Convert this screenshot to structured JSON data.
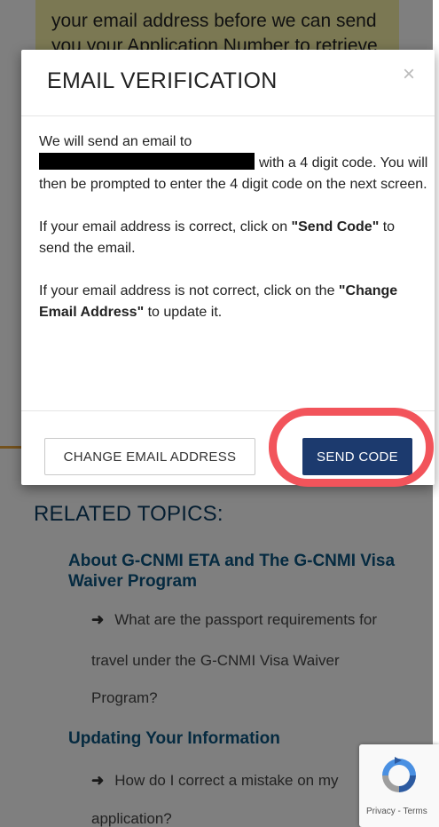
{
  "background": {
    "notice_text": "your email address before we can send you your Application Number to retrieve your",
    "related_title": "RELATED TOPICS:",
    "topics": [
      {
        "heading": "About G-CNMI ETA and The G-CNMI Visa Waiver Program",
        "link_first": "What are the passport requirements for",
        "link_rest_1": "travel under the G-CNMI Visa Waiver",
        "link_rest_2": "Program?"
      },
      {
        "heading": "Updating Your Information",
        "link_first": "How do I correct a mistake on my",
        "link_rest_1": "application?"
      }
    ],
    "arrow": "➜"
  },
  "modal": {
    "title": "EMAIL VERIFICATION",
    "close": "×",
    "p1_line1": "We will send an email to",
    "p1_after_redaction": "with a 4 digit code. You will then be prompted to enter the 4 digit code on the next screen.",
    "p2_before": "If your email address is correct, click on ",
    "p2_bold": "\"Send Code\"",
    "p2_after": " to send the email.",
    "p3_before": "If your email address is not correct, click on the ",
    "p3_bold": "\"Change Email Address\"",
    "p3_after": " to update it.",
    "buttons": {
      "change_email": "CHANGE EMAIL ADDRESS",
      "send_code": "SEND CODE"
    }
  },
  "recaptcha": {
    "label": "Privacy - Terms"
  },
  "colors": {
    "send_button": "#1c3a6e",
    "highlight": "#f2545b",
    "notice_background": "#f6f1a6",
    "heading_blue": "#0b3c63"
  }
}
